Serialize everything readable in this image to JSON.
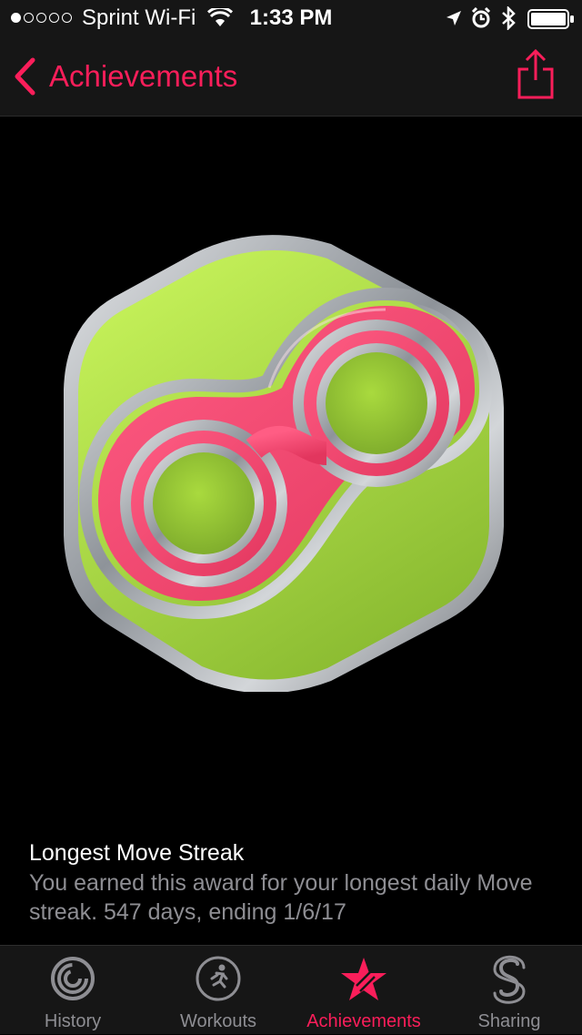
{
  "status_bar": {
    "signal_dots_filled": 1,
    "signal_dots_total": 5,
    "carrier": "Sprint Wi-Fi",
    "time": "1:33 PM",
    "icons": [
      "wifi-icon",
      "location-arrow-icon",
      "alarm-clock-icon",
      "bluetooth-icon",
      "battery-icon"
    ]
  },
  "nav": {
    "back_label": "Achievements",
    "back_icon": "chevron-left-icon",
    "share_icon": "share-icon",
    "accent_color": "#fa1e5a"
  },
  "badge": {
    "icon": "infinity-streak-badge-icon",
    "colors": {
      "fill": "#a8d93f",
      "ribbon": "#f0476c",
      "frame": "#b4b8bd"
    }
  },
  "award": {
    "title": "Longest Move Streak",
    "description": "You earned this award for your longest daily Move streak. 547 days, ending 1/6/17"
  },
  "tabs": [
    {
      "label": "History",
      "icon": "history-rings-icon",
      "active": false
    },
    {
      "label": "Workouts",
      "icon": "workouts-runner-icon",
      "active": false
    },
    {
      "label": "Achievements",
      "icon": "achievements-star-icon",
      "active": true
    },
    {
      "label": "Sharing",
      "icon": "sharing-icon",
      "active": false
    }
  ]
}
